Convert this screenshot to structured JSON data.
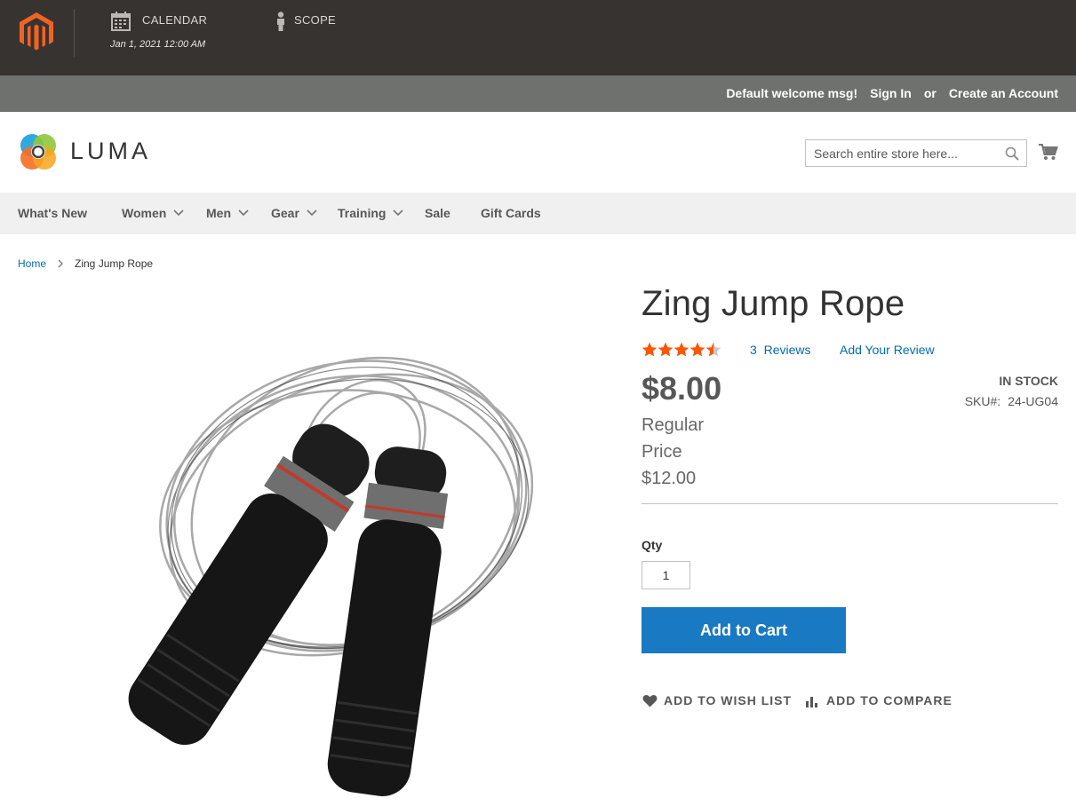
{
  "admin_bar": {
    "calendar_label": "CALENDAR",
    "calendar_value": "Jan 1, 2021 12:00 AM",
    "scope_label": "SCOPE"
  },
  "panel": {
    "welcome": "Default welcome msg!",
    "sign_in": "Sign In",
    "or": "or",
    "create_account": "Create an Account"
  },
  "header": {
    "logo_text": "LUMA",
    "search_placeholder": "Search entire store here..."
  },
  "nav": {
    "items": [
      {
        "label": "What's New"
      },
      {
        "label": "Women"
      },
      {
        "label": "Men"
      },
      {
        "label": "Gear"
      },
      {
        "label": "Training"
      },
      {
        "label": "Sale"
      },
      {
        "label": "Gift Cards"
      }
    ]
  },
  "breadcrumb": {
    "home": "Home",
    "current": "Zing Jump Rope"
  },
  "product": {
    "title": "Zing Jump Rope",
    "rating_percent": 90,
    "reviews_count": "3",
    "reviews_label": "Reviews",
    "add_review": "Add Your Review",
    "price": "$8.00",
    "regular_price_label": "Regular Price",
    "regular_price": "$12.00",
    "stock": "IN STOCK",
    "sku_label": "SKU#:",
    "sku": "24-UG04",
    "qty_label": "Qty",
    "qty_value": "1",
    "add_to_cart": "Add to Cart",
    "wishlist": "ADD TO WISH LIST",
    "compare": "ADD TO COMPARE"
  },
  "colors": {
    "admin_bar": "#373330",
    "panel_header": "#6e716e",
    "accent_blue": "#1979c3",
    "link_blue": "#006bb4",
    "star_orange": "#ff5501",
    "magento_orange": "#f26322"
  }
}
